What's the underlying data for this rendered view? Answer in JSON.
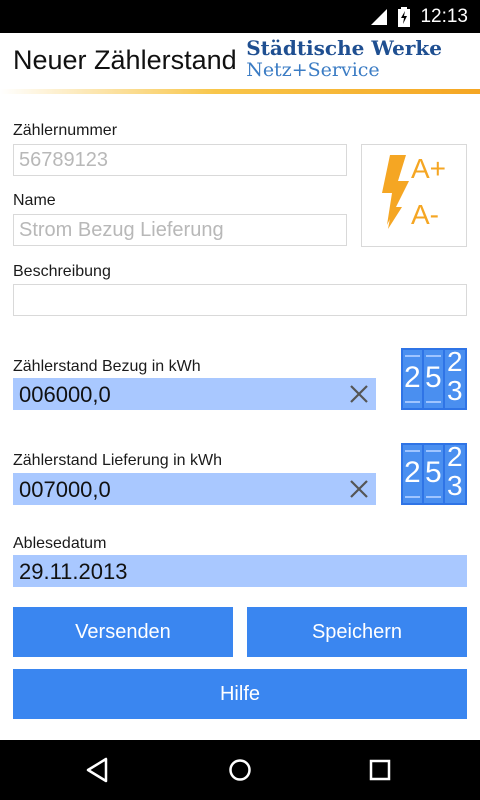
{
  "status_bar": {
    "time": "12:13"
  },
  "app_bar": {
    "title": "Neuer Zählerstand",
    "brand_line1": "Städtische Werke",
    "brand_line2": "Netz+Service"
  },
  "form": {
    "meter_number": {
      "label": "Zählernummer",
      "value": "56789123"
    },
    "name": {
      "label": "Name",
      "value": "Strom Bezug Lieferung"
    },
    "description": {
      "label": "Beschreibung",
      "value": ""
    },
    "reading_consumption": {
      "label": "Zählerstand Bezug in kWh",
      "value": "006000,0"
    },
    "reading_feed_in": {
      "label": "Zählerstand Lieferung in kWh",
      "value": "007000,0"
    },
    "reading_date": {
      "label": "Ablesedatum",
      "value": "29.11.2013"
    }
  },
  "meter_type_icon": {
    "plus": "A+",
    "minus": "A-"
  },
  "counter_icon_digits": [
    "2",
    "5",
    "2",
    "3"
  ],
  "buttons": {
    "send": "Versenden",
    "save": "Speichern",
    "help": "Hilfe"
  },
  "colors": {
    "accent_blue": "#3a86f0",
    "field_highlight": "#a9c8ff",
    "lightning_orange": "#f5a623",
    "brand_blue": "#1f4f91"
  },
  "icons": [
    "sim-icon",
    "battery-icon",
    "lightning-icon",
    "counter-icon",
    "clear-icon",
    "back-icon",
    "home-icon",
    "recents-icon"
  ]
}
